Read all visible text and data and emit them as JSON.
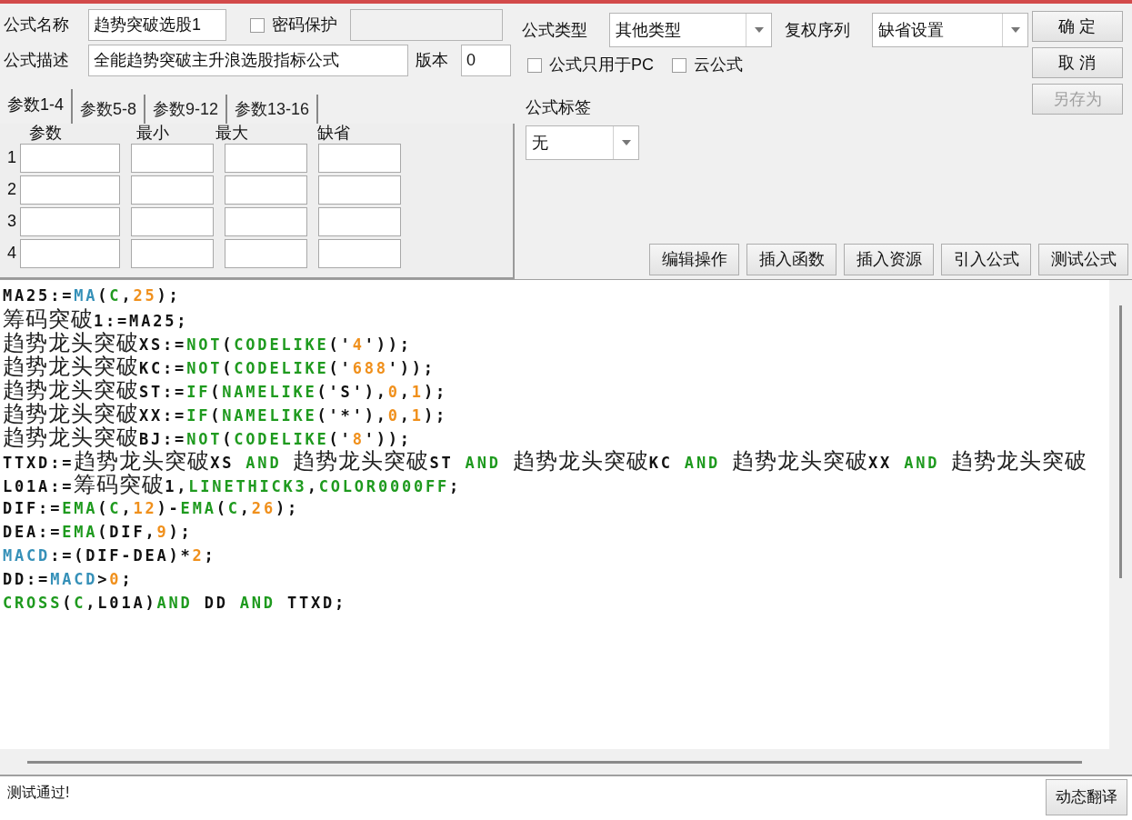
{
  "form": {
    "name": {
      "label": "公式名称",
      "value": "趋势突破选股1"
    },
    "password": {
      "label": "密码保护",
      "checked": false
    },
    "description": {
      "label": "公式描述",
      "value": "全能趋势突破主升浪选股指标公式"
    },
    "version": {
      "label": "版本",
      "value": "0"
    },
    "type": {
      "label": "公式类型",
      "value": "其他类型"
    },
    "adjust": {
      "label": "复权序列",
      "value": "缺省设置"
    },
    "options": [
      {
        "label": "公式只用于PC",
        "checked": false
      },
      {
        "label": "云公式",
        "checked": false
      }
    ],
    "tag": {
      "label": "公式标签",
      "value": "无"
    }
  },
  "dialog_buttons": [
    {
      "label": "确 定",
      "disabled": false
    },
    {
      "label": "取 消",
      "disabled": false
    },
    {
      "label": "另存为",
      "disabled": true
    }
  ],
  "param_tabs": [
    {
      "label": "参数1-4",
      "selected": true
    },
    {
      "label": "参数5-8",
      "selected": false
    },
    {
      "label": "参数9-12",
      "selected": false
    },
    {
      "label": "参数13-16",
      "selected": false
    }
  ],
  "param_columns": [
    "参数",
    "最小",
    "最大",
    "缺省"
  ],
  "param_rows": [
    "1",
    "2",
    "3",
    "4"
  ],
  "tool_buttons": [
    "编辑操作",
    "插入函数",
    "插入资源",
    "引入公式",
    "测试公式"
  ],
  "code_lines": [
    [
      {
        "kind": "plain",
        "text": "MA25:="
      },
      {
        "kind": "builtin",
        "text": "MA"
      },
      {
        "kind": "plain",
        "text": "("
      },
      {
        "kind": "function",
        "text": "C"
      },
      {
        "kind": "plain",
        "text": ","
      },
      {
        "kind": "number",
        "text": "25"
      },
      {
        "kind": "plain",
        "text": ");"
      }
    ],
    [
      {
        "kind": "cjk",
        "text": "筹码突破"
      },
      {
        "kind": "plain",
        "text": "1:=MA25;"
      }
    ],
    [
      {
        "kind": "cjk",
        "text": "趋势龙头突破"
      },
      {
        "kind": "plain",
        "text": "XS:="
      },
      {
        "kind": "function",
        "text": "NOT"
      },
      {
        "kind": "plain",
        "text": "("
      },
      {
        "kind": "function",
        "text": "CODELIKE"
      },
      {
        "kind": "plain",
        "text": "('"
      },
      {
        "kind": "number",
        "text": "4"
      },
      {
        "kind": "plain",
        "text": "'));"
      }
    ],
    [
      {
        "kind": "cjk",
        "text": "趋势龙头突破"
      },
      {
        "kind": "plain",
        "text": "KC:="
      },
      {
        "kind": "function",
        "text": "NOT"
      },
      {
        "kind": "plain",
        "text": "("
      },
      {
        "kind": "function",
        "text": "CODELIKE"
      },
      {
        "kind": "plain",
        "text": "('"
      },
      {
        "kind": "number",
        "text": "688"
      },
      {
        "kind": "plain",
        "text": "'));"
      }
    ],
    [
      {
        "kind": "cjk",
        "text": "趋势龙头突破"
      },
      {
        "kind": "plain",
        "text": "ST:="
      },
      {
        "kind": "function",
        "text": "IF"
      },
      {
        "kind": "plain",
        "text": "("
      },
      {
        "kind": "function",
        "text": "NAMELIKE"
      },
      {
        "kind": "plain",
        "text": "('S'),"
      },
      {
        "kind": "number",
        "text": "0"
      },
      {
        "kind": "plain",
        "text": ","
      },
      {
        "kind": "number",
        "text": "1"
      },
      {
        "kind": "plain",
        "text": ");"
      }
    ],
    [
      {
        "kind": "cjk",
        "text": "趋势龙头突破"
      },
      {
        "kind": "plain",
        "text": "XX:="
      },
      {
        "kind": "function",
        "text": "IF"
      },
      {
        "kind": "plain",
        "text": "("
      },
      {
        "kind": "function",
        "text": "NAMELIKE"
      },
      {
        "kind": "plain",
        "text": "('*'),"
      },
      {
        "kind": "number",
        "text": "0"
      },
      {
        "kind": "plain",
        "text": ","
      },
      {
        "kind": "number",
        "text": "1"
      },
      {
        "kind": "plain",
        "text": ");"
      }
    ],
    [
      {
        "kind": "cjk",
        "text": "趋势龙头突破"
      },
      {
        "kind": "plain",
        "text": "BJ:="
      },
      {
        "kind": "function",
        "text": "NOT"
      },
      {
        "kind": "plain",
        "text": "("
      },
      {
        "kind": "function",
        "text": "CODELIKE"
      },
      {
        "kind": "plain",
        "text": "('"
      },
      {
        "kind": "number",
        "text": "8"
      },
      {
        "kind": "plain",
        "text": "'));"
      }
    ],
    [
      {
        "kind": "plain",
        "text": "TTXD:="
      },
      {
        "kind": "cjk",
        "text": "趋势龙头突破"
      },
      {
        "kind": "plain",
        "text": "XS"
      },
      {
        "kind": "function",
        "text": " AND "
      },
      {
        "kind": "cjk",
        "text": "趋势龙头突破"
      },
      {
        "kind": "plain",
        "text": "ST"
      },
      {
        "kind": "function",
        "text": " AND "
      },
      {
        "kind": "cjk",
        "text": "趋势龙头突破"
      },
      {
        "kind": "plain",
        "text": "KC"
      },
      {
        "kind": "function",
        "text": " AND "
      },
      {
        "kind": "cjk",
        "text": "趋势龙头突破"
      },
      {
        "kind": "plain",
        "text": "XX"
      },
      {
        "kind": "function",
        "text": " AND "
      },
      {
        "kind": "cjk",
        "text": "趋势龙头突破"
      }
    ],
    [
      {
        "kind": "plain",
        "text": "L01A:="
      },
      {
        "kind": "cjk",
        "text": "筹码突破"
      },
      {
        "kind": "plain",
        "text": "1,"
      },
      {
        "kind": "function",
        "text": "LINETHICK3"
      },
      {
        "kind": "plain",
        "text": ","
      },
      {
        "kind": "function",
        "text": "COLOR0000FF"
      },
      {
        "kind": "plain",
        "text": ";"
      }
    ],
    [
      {
        "kind": "plain",
        "text": "DIF:="
      },
      {
        "kind": "function",
        "text": "EMA"
      },
      {
        "kind": "plain",
        "text": "("
      },
      {
        "kind": "function",
        "text": "C"
      },
      {
        "kind": "plain",
        "text": ","
      },
      {
        "kind": "number",
        "text": "12"
      },
      {
        "kind": "plain",
        "text": ")-"
      },
      {
        "kind": "function",
        "text": "EMA"
      },
      {
        "kind": "plain",
        "text": "("
      },
      {
        "kind": "function",
        "text": "C"
      },
      {
        "kind": "plain",
        "text": ","
      },
      {
        "kind": "number",
        "text": "26"
      },
      {
        "kind": "plain",
        "text": ");"
      }
    ],
    [
      {
        "kind": "plain",
        "text": "DEA:="
      },
      {
        "kind": "function",
        "text": "EMA"
      },
      {
        "kind": "plain",
        "text": "(DIF,"
      },
      {
        "kind": "number",
        "text": "9"
      },
      {
        "kind": "plain",
        "text": ");"
      }
    ],
    [
      {
        "kind": "builtin",
        "text": "MACD"
      },
      {
        "kind": "plain",
        "text": ":=(DIF-DEA)*"
      },
      {
        "kind": "number",
        "text": "2"
      },
      {
        "kind": "plain",
        "text": ";"
      }
    ],
    [
      {
        "kind": "plain",
        "text": "DD:="
      },
      {
        "kind": "builtin",
        "text": "MACD"
      },
      {
        "kind": "plain",
        "text": ">"
      },
      {
        "kind": "number",
        "text": "0"
      },
      {
        "kind": "plain",
        "text": ";"
      }
    ],
    [
      {
        "kind": "function",
        "text": "CROSS"
      },
      {
        "kind": "plain",
        "text": "("
      },
      {
        "kind": "function",
        "text": "C"
      },
      {
        "kind": "plain",
        "text": ",L01A)"
      },
      {
        "kind": "function",
        "text": "AND"
      },
      {
        "kind": "plain",
        "text": " DD "
      },
      {
        "kind": "function",
        "text": "AND"
      },
      {
        "kind": "plain",
        "text": " TTXD;"
      }
    ]
  ],
  "status": "测试通过!",
  "translate_button": "动态翻译"
}
